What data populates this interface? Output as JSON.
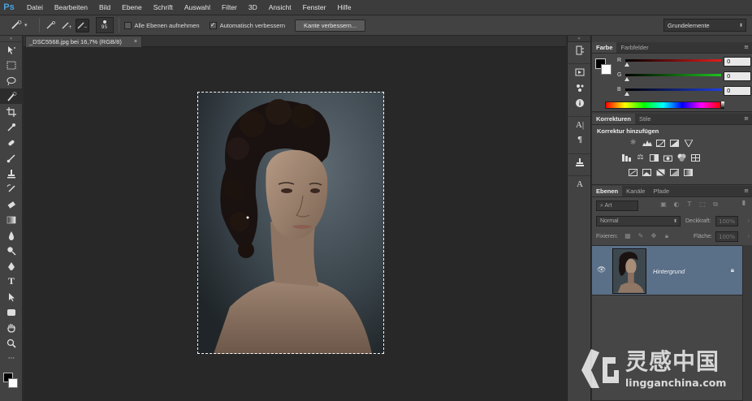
{
  "app": {
    "logo": "Ps"
  },
  "menu": [
    "Datei",
    "Bearbeiten",
    "Bild",
    "Ebene",
    "Schrift",
    "Auswahl",
    "Filter",
    "3D",
    "Ansicht",
    "Fenster",
    "Hilfe"
  ],
  "options": {
    "brush_size": "95",
    "sample_all_layers": "Alle Ebenen aufnehmen",
    "auto_enhance": "Automatisch verbessern",
    "refine_edge": "Kante verbessern...",
    "workspace": "Grundelemente"
  },
  "document": {
    "tab_title": "_DSC5568.jpg bei 16,7% (RGB/8)",
    "close": "×"
  },
  "color_panel": {
    "tabs": [
      "Farbe",
      "Farbfelder"
    ],
    "channels": [
      {
        "label": "R",
        "value": "0",
        "color": "#e21c1c"
      },
      {
        "label": "G",
        "value": "0",
        "color": "#1fc21f"
      },
      {
        "label": "B",
        "value": "0",
        "color": "#1e3fe0"
      }
    ]
  },
  "adjustments_panel": {
    "tabs": [
      "Korrekturen",
      "Stile"
    ],
    "title": "Korrektur hinzufügen"
  },
  "layers_panel": {
    "tabs": [
      "Ebenen",
      "Kanäle",
      "Pfade"
    ],
    "filter_kind": "Art",
    "blend_mode": "Normal",
    "opacity_label": "Deckkraft:",
    "opacity_value": "100%",
    "lock_label": "Fixieren:",
    "fill_label": "Fläche:",
    "fill_value": "100%",
    "layers": [
      {
        "name": "Hintergrund",
        "visible": true,
        "locked": true
      }
    ]
  },
  "watermark": {
    "cn": "灵感中国",
    "en": "lingganchina.com"
  }
}
